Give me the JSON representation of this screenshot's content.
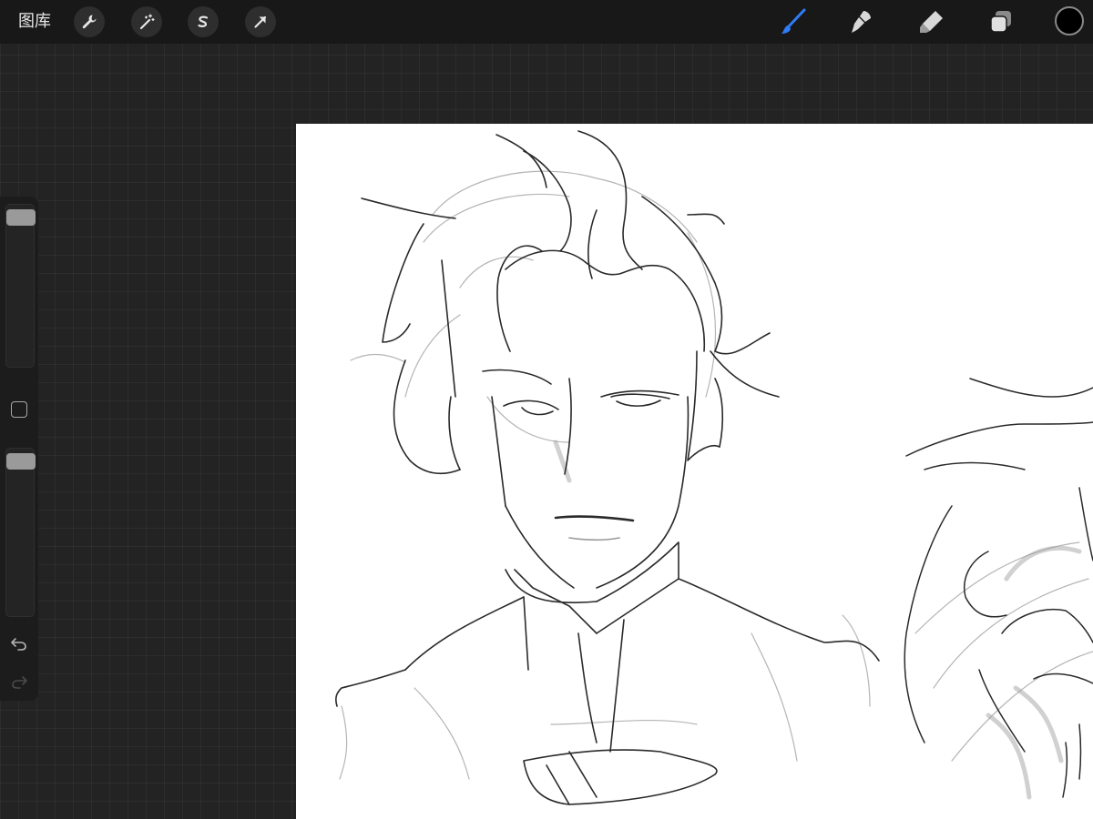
{
  "topbar": {
    "gallery_label": "图库",
    "left_tools": [
      "wrench-icon",
      "magic-wand-icon",
      "selection-icon",
      "arrow-transform-icon"
    ],
    "right_tools": [
      "brush-icon",
      "smudge-icon",
      "eraser-icon",
      "layers-icon"
    ],
    "active_tool": "brush-icon",
    "active_color": "#000000",
    "accent_color": "#2f7cf6"
  },
  "sidebar": {
    "brush_size_level": 0.02,
    "opacity_level": 0.02,
    "buttons": [
      "modify-square-icon",
      "undo-icon",
      "redo-icon"
    ]
  },
  "canvas": {
    "background": "#ffffff",
    "content": "pencil-sketch"
  }
}
